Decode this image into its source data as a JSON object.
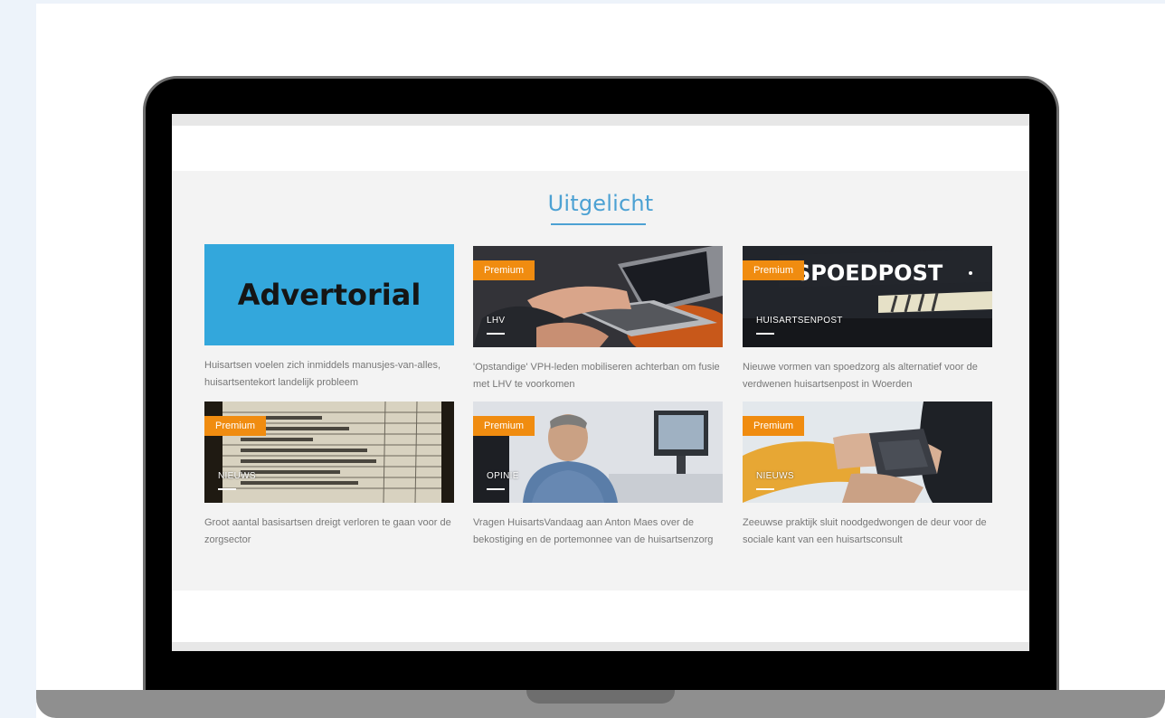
{
  "section": {
    "title": "Uitgelicht"
  },
  "cards": [
    {
      "badge": "",
      "category": "",
      "image_text": "Advertorial",
      "caption": "Huisartsen voelen zich inmiddels manusjes-van-alles, huisartsentekort landelijk probleem"
    },
    {
      "badge": "Premium",
      "category": "LHV",
      "caption": "'Opstandige' VPH-leden mobiliseren achterban om fusie met LHV te voorkomen"
    },
    {
      "badge": "Premium",
      "category": "HUISARTSENPOST",
      "image_text": "SPOEDPOST",
      "caption": "Nieuwe vormen van spoedzorg als alternatief voor de verdwenen huisartsenpost in Woerden"
    },
    {
      "badge": "Premium",
      "category": "NIEUWS",
      "caption": "Groot aantal basisartsen dreigt verloren te gaan voor de zorgsector"
    },
    {
      "badge": "Premium",
      "category": "OPINIE",
      "caption": "Vragen HuisartsVandaag aan Anton Maes over de bekostiging en de portemonnee van de huisartsenzorg"
    },
    {
      "badge": "Premium",
      "category": "NIEUWS",
      "caption": "Zeeuwse praktijk sluit noodgedwongen de deur voor de sociale kant van een huisartsconsult"
    }
  ],
  "colors": {
    "accent": "#4ca1d3",
    "badge": "#f08c10",
    "advertorial_bg": "#33a7dc"
  }
}
